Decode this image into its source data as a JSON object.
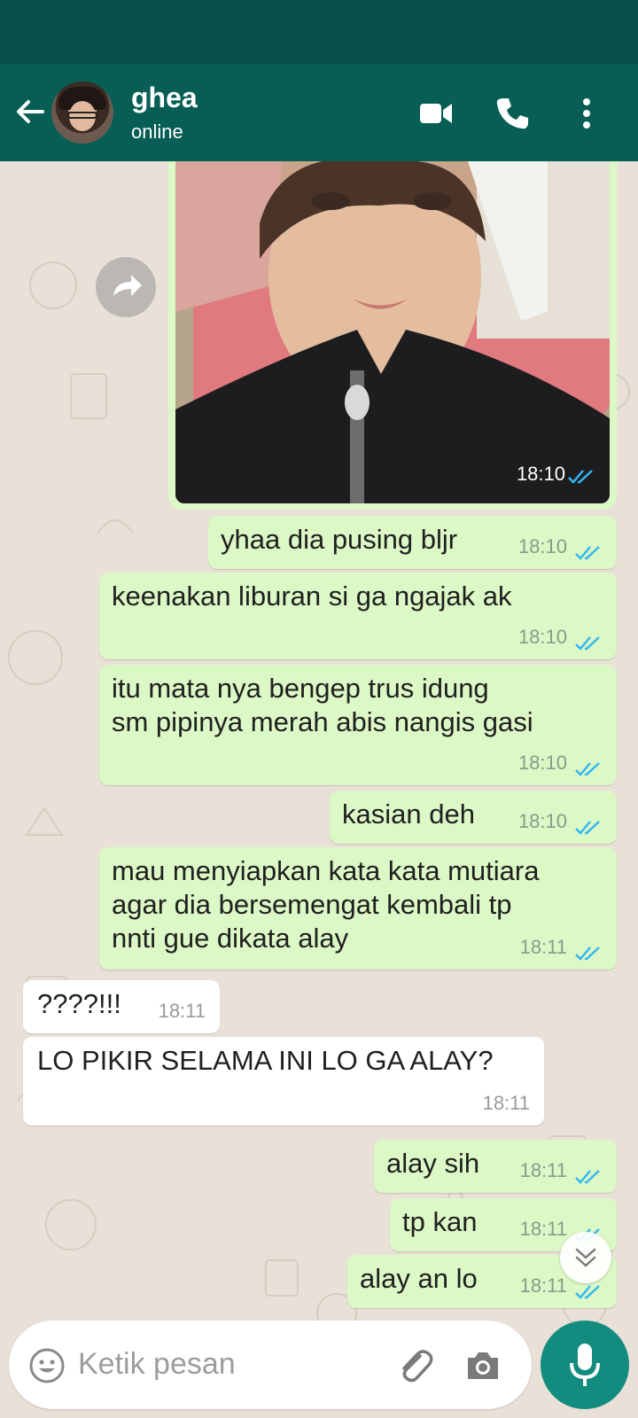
{
  "header": {
    "name": "ghea",
    "status": "online",
    "icons": [
      "back-arrow-icon",
      "video-call-icon",
      "phone-icon",
      "more-options-icon"
    ]
  },
  "messages": [
    {
      "dir": "out",
      "type": "image",
      "time": "18:10",
      "image_desc": "selfie photo"
    },
    {
      "dir": "out",
      "text": "yhaa dia pusing bljr",
      "time": "18:10"
    },
    {
      "dir": "out",
      "text": "keenakan liburan si ga ngajak ak",
      "time": "18:10"
    },
    {
      "dir": "out",
      "text": "itu mata nya bengep trus idung\nsm pipinya merah abis nangis gasi",
      "time": "18:10"
    },
    {
      "dir": "out",
      "text": "kasian deh",
      "time": "18:10"
    },
    {
      "dir": "out",
      "text": "mau menyiapkan kata kata mutiara\nagar dia bersemengat kembali tp\nnnti gue dikata alay",
      "time": "18:11"
    },
    {
      "dir": "in",
      "text": "????!!!",
      "time": "18:11"
    },
    {
      "dir": "in",
      "text": "LO PIKIR SELAMA INI LO GA ALAY?",
      "time": "18:11"
    },
    {
      "dir": "out",
      "text": "alay sih",
      "time": "18:11"
    },
    {
      "dir": "out",
      "text": "tp kan",
      "time": "18:11"
    },
    {
      "dir": "out",
      "text": "alay an lo",
      "time": "18:11"
    }
  ],
  "composer": {
    "placeholder": "Ketik pesan",
    "icons": [
      "emoji-icon",
      "attach-icon",
      "camera-icon",
      "mic-icon"
    ]
  },
  "colors": {
    "header": "#075e54",
    "status_bar": "#074e48",
    "outgoing_bubble": "#dcf8c6",
    "incoming_bubble": "#ffffff",
    "read_ticks": "#34b7f1",
    "mic_button": "#128c7e"
  }
}
